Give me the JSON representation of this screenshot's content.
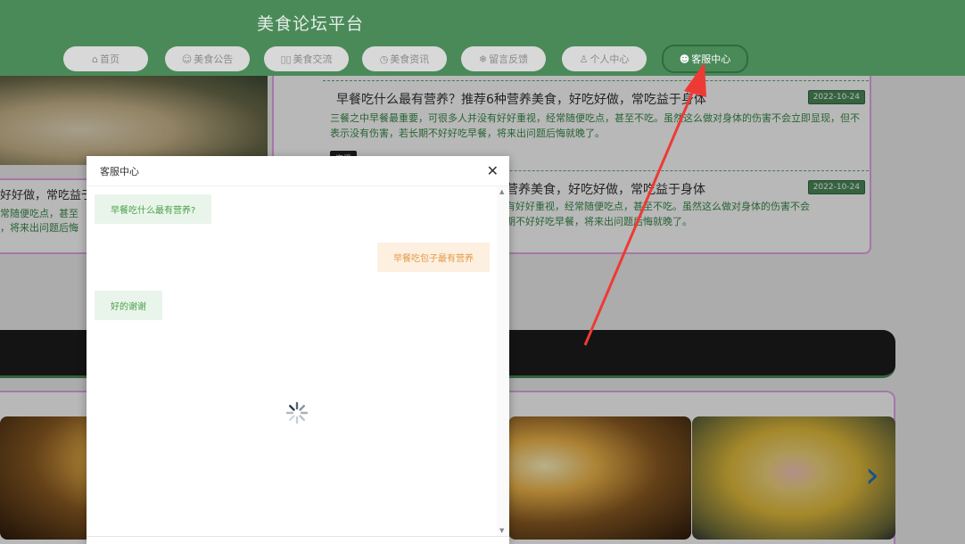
{
  "header": {
    "site_title": "美食论坛平台",
    "nav": [
      {
        "icon": "home-icon",
        "glyph": "⌂",
        "label": "首页"
      },
      {
        "icon": "megaphone-icon",
        "glyph": "☺",
        "label": "美食公告"
      },
      {
        "icon": "chat-icon",
        "glyph": "▯▯",
        "label": "美食交流"
      },
      {
        "icon": "clock-icon",
        "glyph": "◷",
        "label": "美食资讯"
      },
      {
        "icon": "snowflake-icon",
        "glyph": "❄",
        "label": "留言反馈"
      },
      {
        "icon": "user-icon",
        "glyph": "♙",
        "label": "个人中心"
      },
      {
        "icon": "headset-icon",
        "glyph": "☻",
        "label": "客服中心"
      }
    ]
  },
  "news": {
    "left_title": "好好做，常吃益于",
    "left_desc_1": "常随便吃点，甚至",
    "left_desc_2": "，将来出问题后悔",
    "items": [
      {
        "title": "早餐吃什么最有营养？推荐6种营养美食，好吃好做，常吃益于身体",
        "date": "2022-10-24",
        "desc": "三餐之中早餐最重要，可很多人并没有好好重视，经常随便吃点，甚至不吃。虽然这么做对身体的伤害不会立即显现，但不表示没有伤害，若长期不好好吃早餐，将来出问题后悔就晚了。",
        "tag": "资讯"
      },
      {
        "title": "营养美食，好吃好做，常吃益于身体",
        "date": "2022-10-24",
        "desc_1": "有好好重视，经常随便吃点，甚至不吃。虽然这么做对身体的伤害不会",
        "desc_2": "期不好好吃早餐，将来出问题后悔就晚了。"
      }
    ]
  },
  "modal": {
    "title": "客服中心",
    "messages": [
      {
        "side": "left",
        "text": "早餐吃什么最有营养?"
      },
      {
        "side": "right",
        "text": "早餐吃包子最有营养"
      },
      {
        "side": "left",
        "text": "好的谢谢"
      }
    ]
  },
  "colors": {
    "brand_green": "#4a8a59",
    "card_border_pink": "#e7a6ea",
    "arrow_red": "#ee3a35"
  }
}
